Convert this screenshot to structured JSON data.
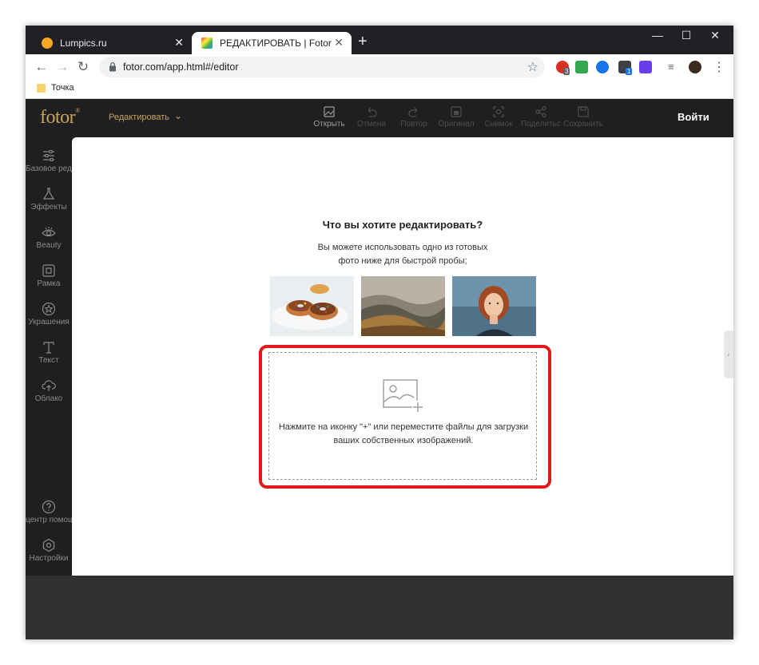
{
  "browser": {
    "tabs": [
      {
        "title": "Lumpics.ru",
        "active": false,
        "favicon_color": "#f9a825"
      },
      {
        "title": "РЕДАКТИРОВАТЬ | Fotor",
        "active": true,
        "favicon_color": "#e53935"
      }
    ],
    "tab_close": "✕",
    "new_tab": "+",
    "window_controls": {
      "minimize": "—",
      "maximize": "☐",
      "close": "✕"
    },
    "url": "fotor.com/app.html#/editor",
    "bookmark": "Точка",
    "extension_badges": [
      "3",
      "1"
    ]
  },
  "app": {
    "logo": "fotor",
    "logo_mark": "®",
    "mode": "Редактировать",
    "toolbar": [
      {
        "label": "Открыть",
        "icon": "open-image-icon",
        "enabled": true
      },
      {
        "label": "Отмена",
        "icon": "undo-icon",
        "enabled": false
      },
      {
        "label": "Повтор",
        "icon": "redo-icon",
        "enabled": false
      },
      {
        "label": "Оригинал",
        "icon": "original-icon",
        "enabled": false
      },
      {
        "label": "Снимок",
        "icon": "snapshot-icon",
        "enabled": false
      },
      {
        "label": "Поделиться",
        "icon": "share-icon",
        "enabled": false
      },
      {
        "label": "Сохранить",
        "icon": "save-icon",
        "enabled": false
      }
    ],
    "login": "Войти",
    "sidebar": [
      {
        "label": "Базовое редактирование",
        "icon": "sliders-icon"
      },
      {
        "label": "Эффекты",
        "icon": "flask-icon"
      },
      {
        "label": "Beauty",
        "icon": "eye-icon"
      },
      {
        "label": "Рамка",
        "icon": "frame-icon"
      },
      {
        "label": "Украшения",
        "icon": "star-icon"
      },
      {
        "label": "Текст",
        "icon": "text-icon"
      },
      {
        "label": "Облако",
        "icon": "cloud-upload-icon"
      }
    ],
    "sidebar_bottom": [
      {
        "label": "центр помощи",
        "icon": "help-icon"
      },
      {
        "label": "Настройки",
        "icon": "settings-icon"
      }
    ],
    "main": {
      "heading": "Что вы хотите редактировать?",
      "subtext": "Вы можете использовать одно из готовых фото ниже для быстрой пробы;",
      "samples": [
        "donuts",
        "hills",
        "portrait"
      ],
      "dropzone_text": "Нажмите на иконку \"+\" или переместите файлы для загрузки ваших собственных изображений."
    },
    "highlight_color": "#e01a1a",
    "accent_color": "#c9a45b"
  }
}
